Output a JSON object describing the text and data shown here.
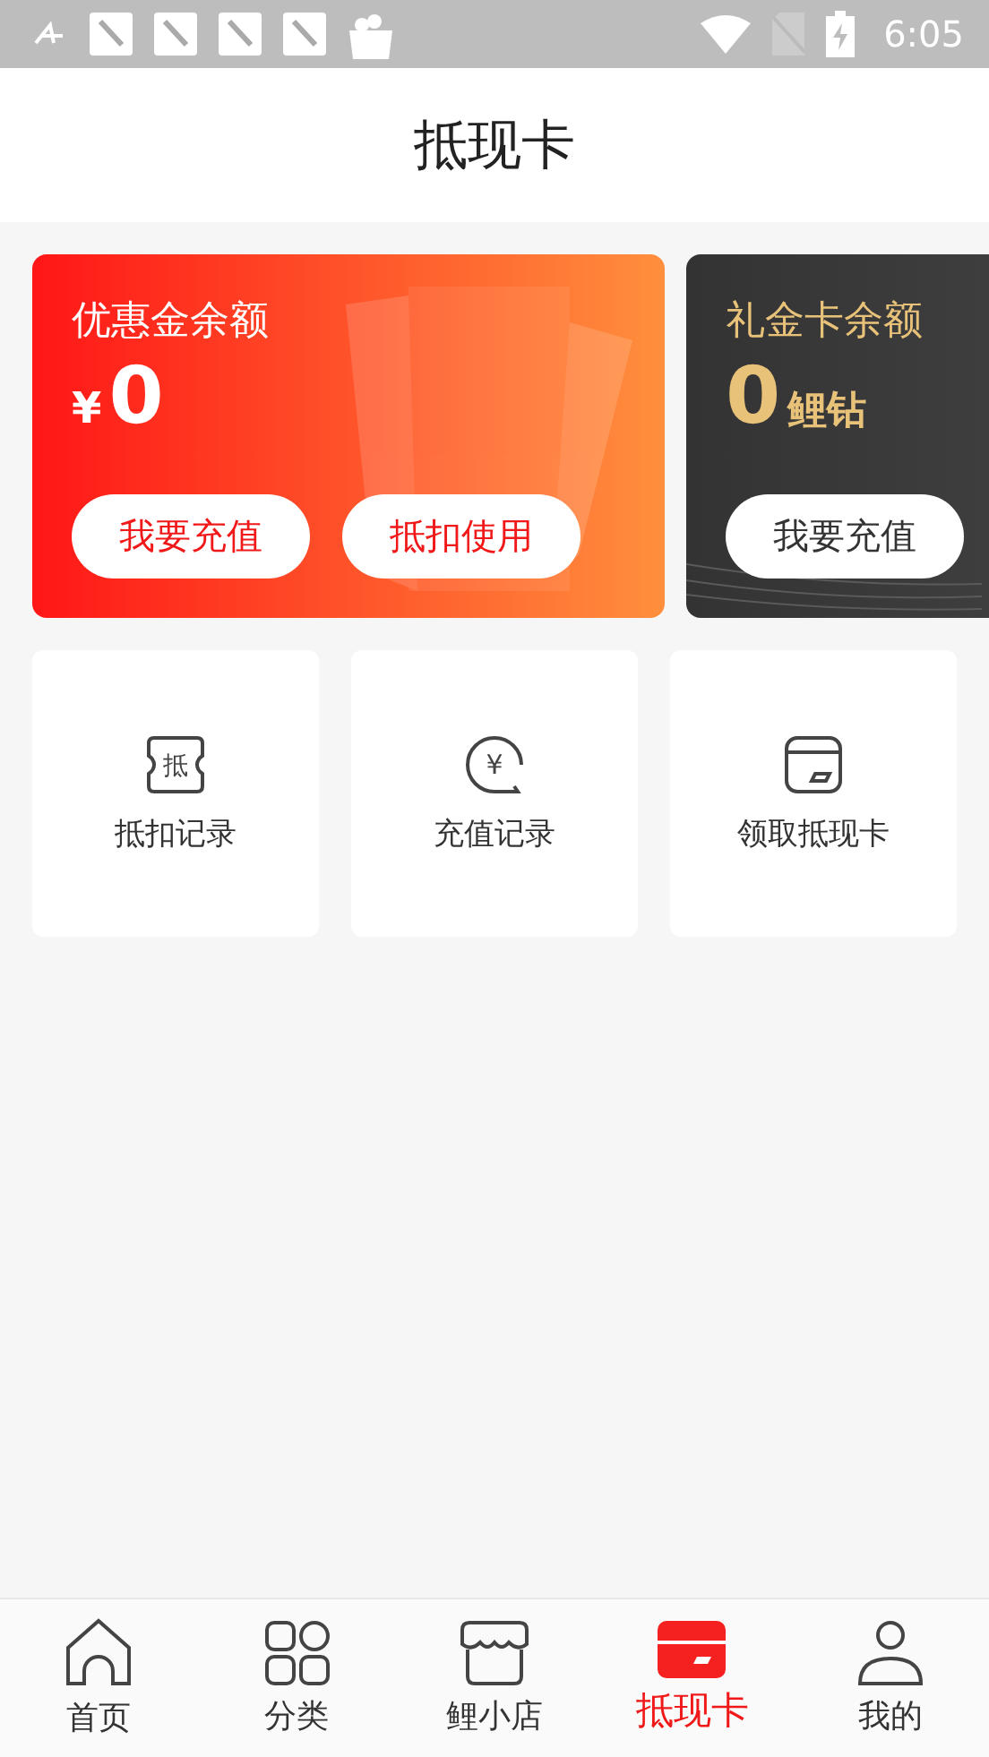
{
  "status_bar": {
    "time": "6:05"
  },
  "header": {
    "title": "抵现卡"
  },
  "cards": [
    {
      "kind": "coupon",
      "title": "优惠金余额",
      "currency": "¥",
      "amount": "0",
      "buttons": [
        "我要充值",
        "抵扣使用"
      ]
    },
    {
      "kind": "gift",
      "title": "礼金卡余额",
      "amount": "0",
      "unit": "鲤钻",
      "buttons": [
        "我要充值"
      ]
    }
  ],
  "tiles": [
    {
      "kind": "ticket",
      "icon_text": "抵",
      "label": "抵扣记录"
    },
    {
      "kind": "bubble",
      "icon_text": "¥",
      "label": "充值记录"
    },
    {
      "kind": "card",
      "label": "领取抵现卡"
    }
  ],
  "tab_bar": [
    {
      "kind": "home",
      "label": "首页",
      "selected": false
    },
    {
      "kind": "grid",
      "label": "分类",
      "selected": false
    },
    {
      "kind": "shop",
      "label": "鲤小店",
      "selected": false
    },
    {
      "kind": "card",
      "label": "抵现卡",
      "selected": true
    },
    {
      "kind": "user",
      "label": "我的",
      "selected": false
    }
  ]
}
